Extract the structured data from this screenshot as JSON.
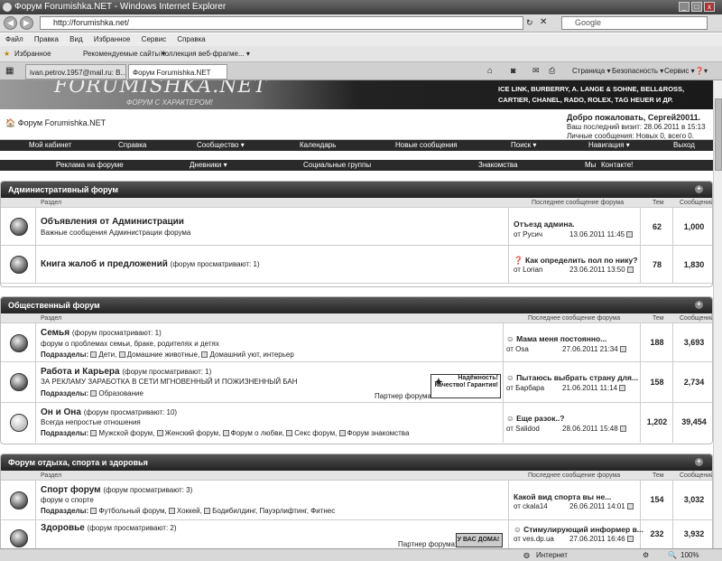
{
  "window": {
    "title": "Форум Forumishka.NET - Windows Internet Explorer"
  },
  "address": {
    "url": "http://forumishka.net/",
    "search_placeholder": "Google"
  },
  "menu": [
    "Файл",
    "Правка",
    "Вид",
    "Избранное",
    "Сервис",
    "Справка"
  ],
  "favbar": {
    "favorites": "Избранное",
    "item1": "Рекомендуемые сайты ▾",
    "item2": "Коллекция веб-фрагме... ▾"
  },
  "tabs": [
    "ivan.petrov.1957@mail.ru: В...",
    "Форум Forumishka.NET"
  ],
  "cmdbar": {
    "page": "Страница ▾",
    "security": "Безопасность ▾",
    "tools": "Сервис ▾",
    "help": "❓▾"
  },
  "banner": {
    "logo": "FORUMISHKA.NET",
    "slogan": "ФОРУМ С ХАРАКТЕРОМ!",
    "brands1": "ICE LINK, BURBERRY, A. LANGE & SOHNE, BELL&ROSS,",
    "brands2": "CARTIER, CHANEL, RADO, ROLEX, TAG HEUER И ДР."
  },
  "header": {
    "site": "Форум Forumishka.NET",
    "welcome": "Добро пожаловать, Сергей20011.",
    "lastvisit": "Ваш последний визит: 28.06.2011 в 15:13",
    "messages": "Личные сообщения: Новых 0, всего 0."
  },
  "nav1": [
    "Мой кабинет",
    "Справка",
    "Сообщество ▾",
    "Календарь",
    "Новые сообщения",
    "Поиск ▾",
    "Навигация ▾",
    "Выход"
  ],
  "nav2": [
    "Реклама на форуме",
    "Дневники ▾",
    "Социальные группы",
    "Знакомства",
    "Мы",
    "Контакте!"
  ],
  "cols": {
    "section": "Раздел",
    "last": "Последнее сообщение форума",
    "topics": "Тем",
    "posts": "Сообщений"
  },
  "sections": [
    {
      "title": "Административный форум",
      "forums": [
        {
          "title": "Объявления от Администрации",
          "viewing": "",
          "desc": "Важные сообщения Администрации форума",
          "sub_label": "",
          "subs": [],
          "lp_title": "Отъезд админа.",
          "lp_user": "от Русич",
          "lp_date": "13.06.2011 11:45",
          "topics": "62",
          "posts": "1,000"
        },
        {
          "title": "Книга жалоб и предложений",
          "viewing": "(форум просматривают: 1)",
          "desc": "",
          "sub_label": "",
          "subs": [],
          "lp_title": "Как определить пол по нику?",
          "lp_user": "от Lorian",
          "lp_date": "23.06.2011 13:50",
          "topics": "78",
          "posts": "1,830"
        }
      ]
    },
    {
      "title": "Общественный форум",
      "forums": [
        {
          "title": "Семья",
          "viewing": "(форум просматривают: 1)",
          "desc": "форум о проблемах семьи, браке, родителях и детях",
          "sub_label": "Подразделы:",
          "subs": [
            "Дети,",
            "Домашние животные,",
            "Домашний уют, интерьер"
          ],
          "lp_title": "Мама меня постоянно...",
          "lp_user": "от Osa",
          "lp_date": "27.06.2011 21:34",
          "topics": "188",
          "posts": "3,693"
        },
        {
          "title": "Работа и Карьера",
          "viewing": "(форум просматривают: 1)",
          "desc": "ЗА РЕКЛАМУ ЗАРАБОТКА В СЕТИ МГНОВЕННЫЙ И ПОЖИЗНЕННЫЙ БАН",
          "sub_label": "Подразделы:",
          "subs": [
            "Образование"
          ],
          "partner": "Партнер форума:",
          "ad": "Надёжность! Качество! Гарантия!",
          "lp_title": "Пытаюсь выбрать страну для...",
          "lp_user": "от Барбара",
          "lp_date": "21.06.2011 11:14",
          "topics": "158",
          "posts": "2,734"
        },
        {
          "title": "Он и Она",
          "viewing": "(форум просматривают: 10)",
          "desc": "Всегда непростые отношения",
          "sub_label": "Подразделы:",
          "subs": [
            "Мужской форум,",
            "Женский форум,",
            "Форум о любви,",
            "Секс форум,",
            "Форум знакомства"
          ],
          "lp_title": "Еще разок..?",
          "lp_user": "от Salidod",
          "lp_date": "28.06.2011 15:48",
          "topics": "1,202",
          "posts": "39,454"
        }
      ]
    },
    {
      "title": "Форум отдыха, спорта и здоровья",
      "forums": [
        {
          "title": "Спорт форум",
          "viewing": "(форум просматривают: 3)",
          "desc": "форум о спорте",
          "sub_label": "Подразделы:",
          "subs": [
            "Футбольный форум,",
            "Хоккей,",
            "Бодибилдинг, Пауэрлифтинг, Фитнес"
          ],
          "lp_title": "Какой вид спорта вы не...",
          "lp_user": "от ckala14",
          "lp_date": "26.06.2011 14:01",
          "topics": "154",
          "posts": "3,032"
        },
        {
          "title": "Здоровье",
          "viewing": "(форум просматривают: 2)",
          "desc": "",
          "sub_label": "",
          "subs": [],
          "partner": "Партнер форума:",
          "ad": "У ВАС ДОМА!",
          "lp_title": "Стимулирующий информер в...",
          "lp_user": "от ves.dp.ua",
          "lp_date": "27.06.2011 16:46",
          "topics": "232",
          "posts": "3,932"
        }
      ]
    }
  ],
  "status": {
    "zone": "Интернет",
    "zoom": "100%"
  }
}
